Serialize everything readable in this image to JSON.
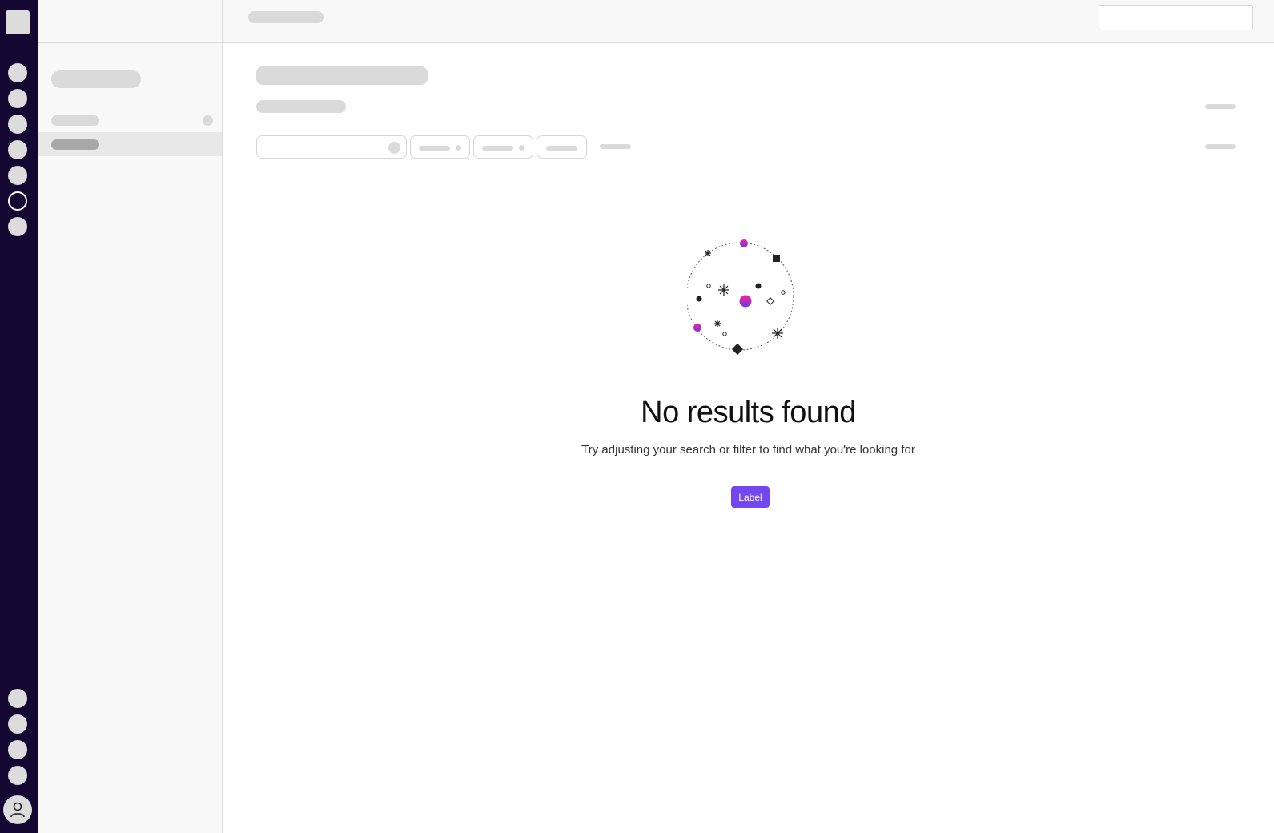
{
  "colors": {
    "rail_bg": "#140832",
    "accent": "#7346f0",
    "skeleton": "#dadada",
    "magenta_dot": "#e6188c"
  },
  "rail": {
    "icons": [
      "app-icon-1",
      "app-icon-2",
      "app-icon-3",
      "app-icon-4",
      "app-icon-5",
      "app-icon-6-active",
      "app-icon-7"
    ],
    "bottom_icons": [
      "settings-icon-1",
      "settings-icon-2",
      "settings-icon-3",
      "settings-icon-4"
    ],
    "avatar_icon": "user-icon"
  },
  "empty_state": {
    "title": "No results found",
    "description": "Try adjusting your search or filter to find what you're looking for",
    "button_label": "Label"
  }
}
